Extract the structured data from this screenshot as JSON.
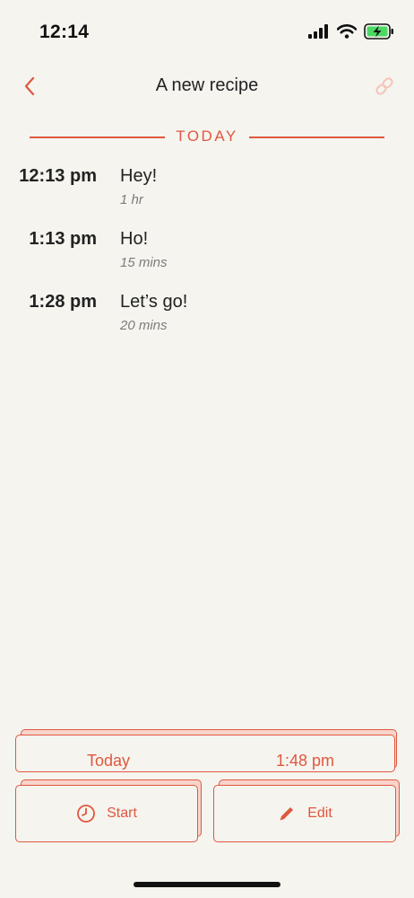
{
  "status_bar": {
    "time": "12:14",
    "icons": [
      "cellular-signal-icon",
      "wifi-icon",
      "battery-charging-icon"
    ]
  },
  "nav": {
    "title": "A new recipe",
    "back_icon": "chevron-left-icon",
    "link_icon": "link-icon"
  },
  "section": {
    "label": "TODAY"
  },
  "steps": [
    {
      "time": "12:13 pm",
      "name": "Hey!",
      "duration": "1 hr"
    },
    {
      "time": "1:13 pm",
      "name": "Ho!",
      "duration": "15 mins"
    },
    {
      "time": "1:28 pm",
      "name": "Let’s go!",
      "duration": "20 mins"
    }
  ],
  "schedule": {
    "date_label": "Today",
    "time_label": "1:48 pm"
  },
  "actions": {
    "start_label": "Start",
    "start_icon": "clock-icon",
    "edit_label": "Edit",
    "edit_icon": "pencil-icon"
  },
  "colors": {
    "accent": "#e0573f",
    "background": "#f5f4ef",
    "battery": "#4cd964"
  }
}
